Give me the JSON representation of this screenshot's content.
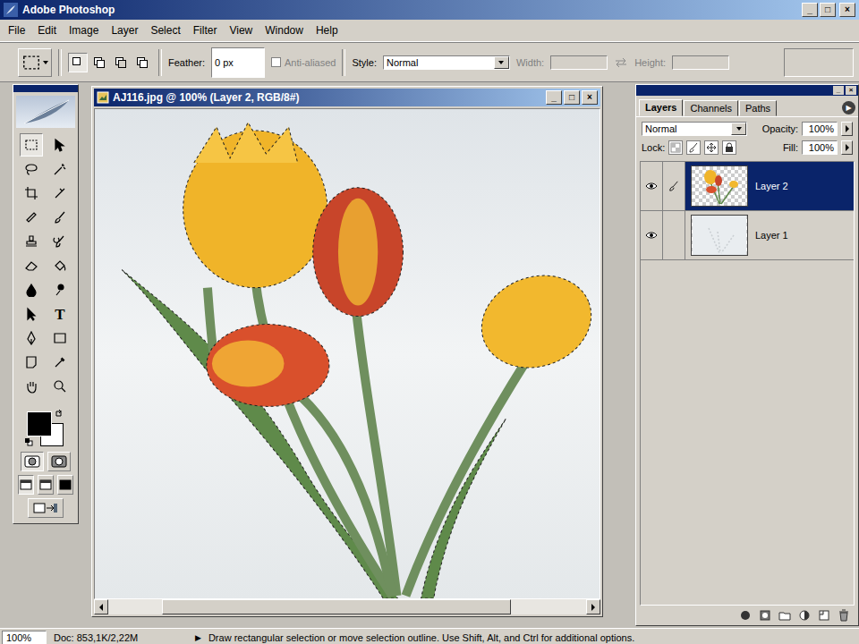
{
  "window": {
    "title": "Adobe Photoshop",
    "controls": [
      "_",
      "□",
      "×"
    ]
  },
  "menu": [
    "File",
    "Edit",
    "Image",
    "Layer",
    "Select",
    "Filter",
    "View",
    "Window",
    "Help"
  ],
  "options_bar": {
    "selection_modes": [
      {
        "selected": true
      },
      {
        "selected": false
      },
      {
        "selected": false
      },
      {
        "selected": false
      }
    ],
    "feather_label": "Feather:",
    "feather_value": "0 px",
    "anti_aliased": {
      "label": "Anti-aliased",
      "checked": false,
      "disabled": true
    },
    "style_label": "Style:",
    "style_value": "Normal",
    "width_label": "Width:",
    "height_label": "Height:",
    "size_disabled": true
  },
  "toolbox": {
    "tools": [
      {
        "selected": true
      },
      {
        "selected": false
      },
      {
        "selected": false
      },
      {
        "selected": false
      },
      {
        "selected": false
      },
      {
        "selected": false
      },
      {
        "selected": false
      },
      {
        "selected": false
      },
      {
        "selected": false
      },
      {
        "selected": false
      },
      {
        "selected": false
      },
      {
        "selected": false
      },
      {
        "selected": false
      },
      {
        "selected": false
      },
      {
        "selected": false
      },
      {
        "selected": false,
        "glyph": "T"
      },
      {
        "selected": false
      },
      {
        "selected": false
      },
      {
        "selected": false
      },
      {
        "selected": false
      },
      {
        "selected": false
      },
      {
        "selected": false
      }
    ],
    "foreground": "#000000",
    "background": "#ffffff",
    "mask_modes": [
      {
        "selected": true
      },
      {
        "selected": false
      }
    ],
    "screen_modes": [
      {
        "selected": true
      },
      {
        "selected": false
      },
      {
        "selected": false
      }
    ]
  },
  "document": {
    "title": "AJ116.jpg @ 100% (Layer 2, RGB/8#)",
    "controls": [
      "_",
      "□",
      "×"
    ]
  },
  "layers_panel": {
    "controls": [
      "_",
      "×"
    ],
    "menu_glyph": "▶",
    "tabs": [
      {
        "label": "Layers",
        "selected": true
      },
      {
        "label": "Channels",
        "selected": false
      },
      {
        "label": "Paths",
        "selected": false
      }
    ],
    "blend_mode": "Normal",
    "opacity_label": "Opacity:",
    "opacity_value": "100%",
    "lock_label": "Lock:",
    "fill_label": "Fill:",
    "fill_value": "100%",
    "layers": [
      {
        "name": "Layer 2",
        "visible": true,
        "selected": true,
        "brush": true
      },
      {
        "name": "Layer 1",
        "visible": true,
        "selected": false,
        "brush": false
      }
    ]
  },
  "status_bar": {
    "zoom": "100%",
    "doc": "Doc: 853,1K/2,22M",
    "arrow": "▶",
    "hint": "Draw rectangular selection or move selection outline. Use Shift, Alt, and Ctrl for additional options."
  }
}
